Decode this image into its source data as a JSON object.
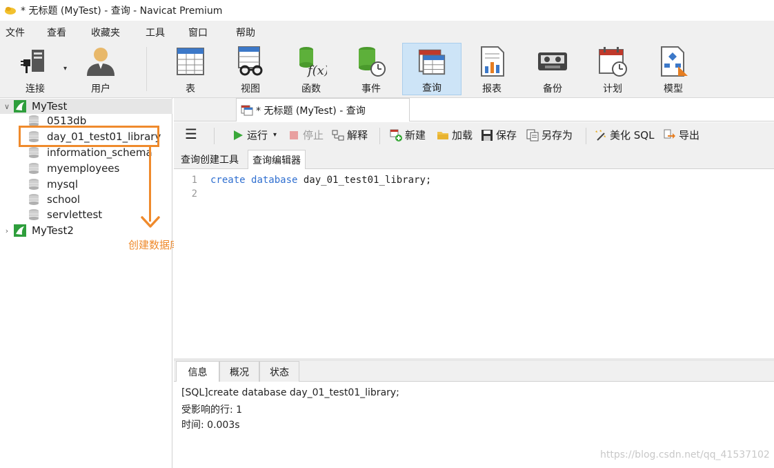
{
  "window": {
    "title": "* 无标题 (MyTest) - 查询 - Navicat Premium"
  },
  "menu": [
    "文件",
    "查看",
    "收藏夹",
    "工具",
    "窗口",
    "帮助"
  ],
  "toolbar": {
    "buttons": [
      {
        "label": "连接",
        "icon": "connection-icon"
      },
      {
        "label": "用户",
        "icon": "user-icon"
      },
      {
        "label": "表",
        "icon": "table-icon"
      },
      {
        "label": "视图",
        "icon": "view-icon"
      },
      {
        "label": "函数",
        "icon": "function-icon"
      },
      {
        "label": "事件",
        "icon": "event-icon"
      },
      {
        "label": "查询",
        "icon": "query-icon",
        "active": true
      },
      {
        "label": "报表",
        "icon": "report-icon"
      },
      {
        "label": "备份",
        "icon": "backup-icon"
      },
      {
        "label": "计划",
        "icon": "schedule-icon"
      },
      {
        "label": "模型",
        "icon": "model-icon"
      }
    ]
  },
  "tree": {
    "connections": [
      {
        "name": "MyTest",
        "expanded": true,
        "databases": [
          "0513db",
          "day_01_test01_library",
          "information_schema",
          "myemployees",
          "mysql",
          "school",
          "servlettest"
        ]
      },
      {
        "name": "MyTest2",
        "expanded": false,
        "databases": []
      }
    ],
    "annotation": "创建数据库成功"
  },
  "document_tab": {
    "label": "* 无标题 (MyTest) - 查询"
  },
  "query_toolbar": {
    "run": "运行",
    "stop": "停止",
    "explain": "解释",
    "new": "新建",
    "load": "加载",
    "save": "保存",
    "save_as": "另存为",
    "beautify": "美化 SQL",
    "export": "导出"
  },
  "editor_tabs": [
    "查询创建工具",
    "查询编辑器"
  ],
  "editor": {
    "line_numbers": [
      "1",
      "2"
    ],
    "line1_kw1": "create",
    "line1_kw2": "database",
    "line1_rest": " day_01_test01_library;"
  },
  "result_tabs": [
    "信息",
    "概况",
    "状态"
  ],
  "output": {
    "line1": "[SQL]create database day_01_test01_library;",
    "line2": "受影响的行: 1",
    "line3": "时间: 0.003s"
  },
  "watermark": "https://blog.csdn.net/qq_41537102",
  "colors": {
    "accent_orange": "#ef8a2c",
    "keyword_blue": "#2f6fd0",
    "active_tab_bg": "#cde4f7"
  }
}
